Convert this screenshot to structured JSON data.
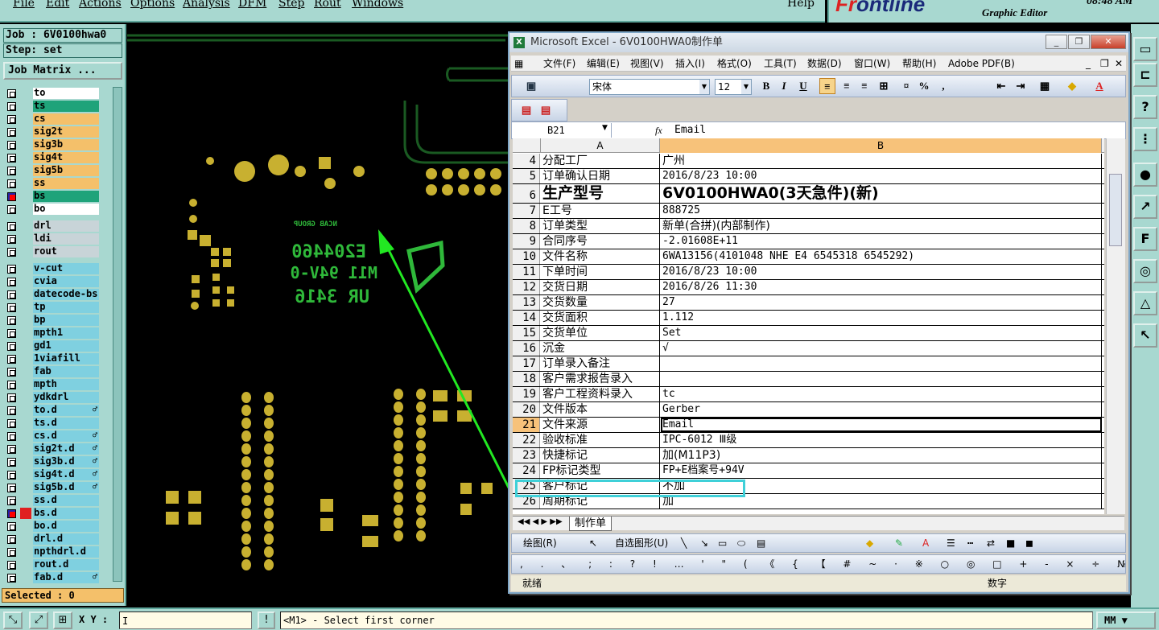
{
  "menu": [
    "File",
    "Edit",
    "Actions",
    "Options",
    "Analysis",
    "DFM",
    "Step",
    "Rout",
    "Windows"
  ],
  "help": "Help",
  "brand": {
    "logo_a": "Fr",
    "logo_b": "o",
    "logo_c": "ntline",
    "sub": "Graphic Editor",
    "clock": "08:48 AM"
  },
  "left": {
    "job": "Job : 6V0100hwa0",
    "step": "Step: set",
    "job_matrix": "Job Matrix ...",
    "selected": "Selected : 0",
    "layers": [
      {
        "name": "to",
        "bg": "#ffffff"
      },
      {
        "name": "ts",
        "bg": "#1fa37a"
      },
      {
        "name": "cs",
        "bg": "#f4c06a"
      },
      {
        "name": "sig2t",
        "bg": "#f4c06a"
      },
      {
        "name": "sig3b",
        "bg": "#f4c06a"
      },
      {
        "name": "sig4t",
        "bg": "#f4c06a"
      },
      {
        "name": "sig5b",
        "bg": "#f4c06a"
      },
      {
        "name": "ss",
        "bg": "#f4c06a"
      },
      {
        "name": "bs",
        "bg": "#1fa37a",
        "marked": true
      },
      {
        "name": "bo",
        "bg": "#ffffff"
      },
      {
        "gap": true
      },
      {
        "name": "drl",
        "bg": "#c8d4d8"
      },
      {
        "name": "ldi",
        "bg": "#c8d4d8"
      },
      {
        "name": "rout",
        "bg": "#c8d4d8"
      },
      {
        "gap": true
      },
      {
        "name": "v-cut",
        "bg": "#7fd0e0"
      },
      {
        "name": "cvia",
        "bg": "#7fd0e0"
      },
      {
        "name": "datecode-bs",
        "bg": "#7fd0e0"
      },
      {
        "name": "tp",
        "bg": "#7fd0e0"
      },
      {
        "name": "bp",
        "bg": "#7fd0e0"
      },
      {
        "name": "mpth1",
        "bg": "#7fd0e0"
      },
      {
        "name": "gd1",
        "bg": "#7fd0e0"
      },
      {
        "name": "1viafill",
        "bg": "#7fd0e0"
      },
      {
        "name": "fab",
        "bg": "#7fd0e0"
      },
      {
        "name": "mpth",
        "bg": "#7fd0e0"
      },
      {
        "name": "ydkdrl",
        "bg": "#7fd0e0"
      },
      {
        "name": "to.d",
        "bg": "#7fd0e0",
        "flag": "♂"
      },
      {
        "name": "ts.d",
        "bg": "#7fd0e0"
      },
      {
        "name": "cs.d",
        "bg": "#7fd0e0",
        "flag": "♂"
      },
      {
        "name": "sig2t.d",
        "bg": "#7fd0e0",
        "flag": "♂"
      },
      {
        "name": "sig3b.d",
        "bg": "#7fd0e0",
        "flag": "♂"
      },
      {
        "name": "sig4t.d",
        "bg": "#7fd0e0",
        "flag": "♂"
      },
      {
        "name": "sig5b.d",
        "bg": "#7fd0e0",
        "flag": "♂"
      },
      {
        "name": "ss.d",
        "bg": "#7fd0e0"
      },
      {
        "name": "bs.d",
        "bg": "#7fd0e0",
        "marked": true,
        "redsq": true
      },
      {
        "name": "bo.d",
        "bg": "#7fd0e0"
      },
      {
        "name": "drl.d",
        "bg": "#7fd0e0"
      },
      {
        "name": "npthdrl.d",
        "bg": "#7fd0e0"
      },
      {
        "name": "rout.d",
        "bg": "#7fd0e0"
      },
      {
        "name": "fab.d",
        "bg": "#7fd0e0",
        "flag": "♂"
      }
    ]
  },
  "bottom": {
    "xy_label": "X Y :",
    "xy_value": "I",
    "status": "<M1> - Select first corner",
    "units": "MM"
  },
  "pcb_text": {
    "line1": "E204460",
    "line2": "M11 94V-0",
    "line3": "UR 3416",
    "logo": "NCAB GROUP"
  },
  "excel": {
    "title": "Microsoft Excel - 6V0100HWA0制作单",
    "menu": [
      "文件(F)",
      "编辑(E)",
      "视图(V)",
      "插入(I)",
      "格式(O)",
      "工具(T)",
      "数据(D)",
      "窗口(W)",
      "帮助(H)",
      "Adobe PDF(B)"
    ],
    "font": "宋体",
    "size": "12",
    "name_box": "B21",
    "fx": "fx",
    "formula": "Email",
    "col_a": "A",
    "col_b": "B",
    "rows": [
      {
        "n": "4",
        "a": "分配工厂",
        "b": "广州",
        "zh": true
      },
      {
        "n": "5",
        "a": "订单确认日期",
        "b": "2016/8/23 10:00"
      },
      {
        "n": "6",
        "a": "生产型号",
        "b": "6V0100HWA0(3天急件)(新)",
        "big": true
      },
      {
        "n": "7",
        "a": "E工号",
        "b": "888725"
      },
      {
        "n": "8",
        "a": "订单类型",
        "b": "新单(合拼)(内部制作)",
        "zh": true
      },
      {
        "n": "9",
        "a": "合同序号",
        "b": "-2.01608E+11"
      },
      {
        "n": "10",
        "a": "文件名称",
        "b": "6WA13156(4101048 NHE E4 6545318 6545292)"
      },
      {
        "n": "11",
        "a": "下单时间",
        "b": "2016/8/23 10:00"
      },
      {
        "n": "12",
        "a": "交货日期",
        "b": "2016/8/26 11:30"
      },
      {
        "n": "13",
        "a": "交货数量",
        "b": "27"
      },
      {
        "n": "14",
        "a": "交货面积",
        "b": "1.112"
      },
      {
        "n": "15",
        "a": "交货单位",
        "b": "Set"
      },
      {
        "n": "16",
        "a": "沉金",
        "b": "√"
      },
      {
        "n": "17",
        "a": "订单录入备注",
        "b": ""
      },
      {
        "n": "18",
        "a": "客户需求报告录入",
        "b": ""
      },
      {
        "n": "19",
        "a": "客户工程资料录入",
        "b": "tc"
      },
      {
        "n": "20",
        "a": "文件版本",
        "b": "Gerber"
      },
      {
        "n": "21",
        "a": "文件来源",
        "b": "Email",
        "active": true
      },
      {
        "n": "22",
        "a": "验收标准",
        "b": "IPC-6012 Ⅲ级"
      },
      {
        "n": "23",
        "a": "快捷标记",
        "b": "加(M11P3)",
        "zh": true
      },
      {
        "n": "24",
        "a": "FP标记类型",
        "b": "FP+E档案号+94V"
      },
      {
        "n": "25",
        "a": "客户标记",
        "b": "不加",
        "zh": true
      },
      {
        "n": "26",
        "a": "周期标记",
        "b": "加",
        "zh": true
      }
    ],
    "sheet_tab": "制作单",
    "draw_label": "绘图(R)",
    "autoshape_label": "自选图形(U)",
    "symbols": ", . 、 ; : ? ! … ' \" ( 《 { 【 # ~ · ※ ○ ◎ □ + - × ÷ № $ ¥ § %",
    "status_left": "就绪",
    "status_right": "数字"
  },
  "colors": {
    "teal": "#a8d8d0",
    "pad": "#c8b030",
    "trace": "#1a4a1a",
    "arrow": "#22e822",
    "highlight": "#3fd0d8"
  }
}
